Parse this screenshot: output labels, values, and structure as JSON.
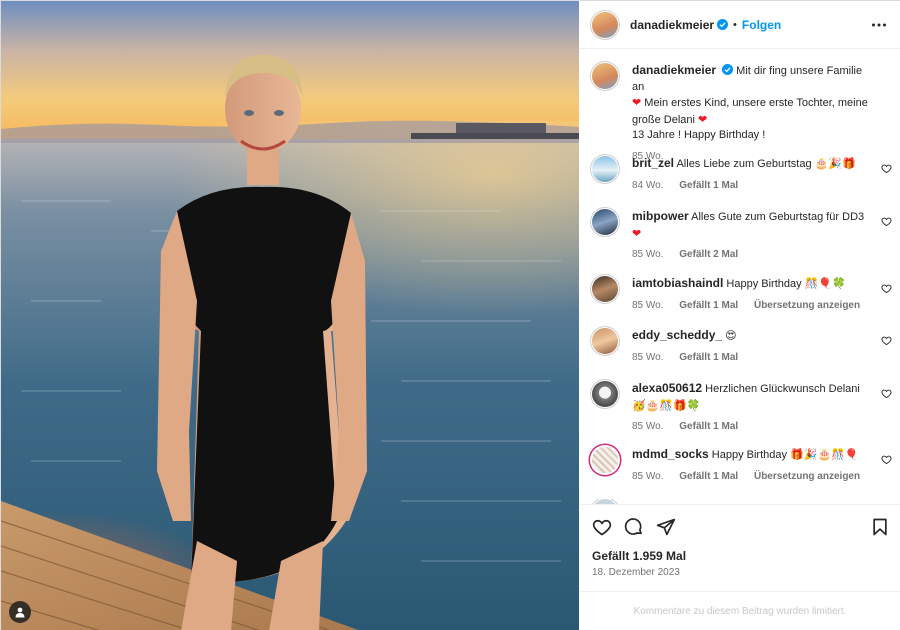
{
  "post": {
    "username": "danadiekmeier",
    "follow_label": "Folgen",
    "separator": "•",
    "caption_line1": "Mit dir fing unsere Familie an",
    "caption_line2": "Mein erstes Kind, unsere erste Tochter, meine große Delani",
    "caption_line3": "13 Jahre ! Happy Birthday !",
    "caption_time": "85 Wo.",
    "likes": "Gefällt 1.959 Mal",
    "date": "18. Dezember 2023",
    "comments_limited": "Kommentare zu diesem Beitrag wurden limitiert."
  },
  "comments": [
    {
      "user": "brit_zel",
      "text": "Alles Liebe zum Geburtstag",
      "emoji": "🎂🎉🎁",
      "time": "84 Wo.",
      "likes": "Gefällt 1 Mal",
      "translate": ""
    },
    {
      "user": "mibpower",
      "text": "Alles Gute zum Geburtstag für DD3",
      "emoji": "❤",
      "time": "85 Wo.",
      "likes": "Gefällt 2 Mal",
      "translate": ""
    },
    {
      "user": "iamtobiashaindl",
      "text": "Happy Birthday",
      "emoji": "🎊🎈🍀",
      "time": "85 Wo.",
      "likes": "Gefällt 1 Mal",
      "translate": "Übersetzung anzeigen"
    },
    {
      "user": "eddy_scheddy_",
      "text": "",
      "emoji": "😍",
      "time": "85 Wo.",
      "likes": "Gefällt 1 Mal",
      "translate": ""
    },
    {
      "user": "alexa050612",
      "text": "Herzlichen Glückwunsch Delani",
      "emoji": "🥳🎂🎊🎁🍀",
      "time": "85 Wo.",
      "likes": "Gefällt 1 Mal",
      "translate": ""
    },
    {
      "user": "mdmd_socks",
      "text": "Happy Birthday",
      "emoji": "🎁🎉🎂🎊🎈",
      "time": "85 Wo.",
      "likes": "Gefällt 1 Mal",
      "translate": "Übersetzung anzeigen"
    }
  ],
  "colors": {
    "accent": "#0095f6",
    "heart": "#ed1c24",
    "muted": "#737373"
  },
  "icons": [
    "more-icon",
    "verified-icon",
    "heart-icon",
    "comment-icon",
    "share-icon",
    "bookmark-icon",
    "user-tag-icon"
  ]
}
